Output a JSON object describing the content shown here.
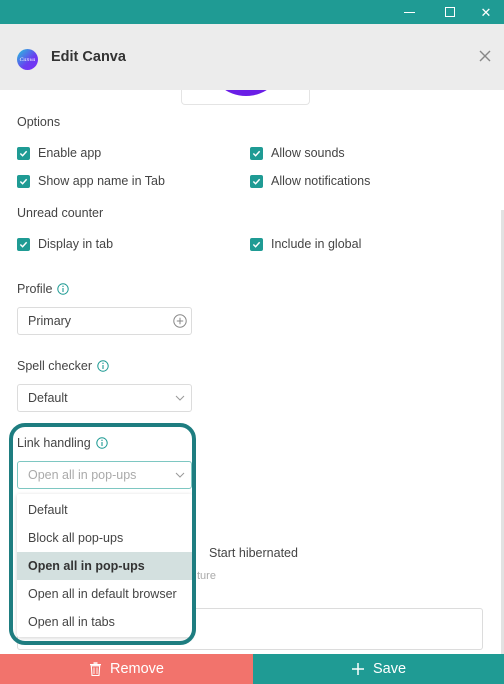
{
  "window": {
    "minimize_glyph": "",
    "maximize_glyph": "",
    "close_glyph": "✕"
  },
  "header": {
    "logo_text": "Canva",
    "title": "Edit Canva",
    "close_icon": "close-icon"
  },
  "options": {
    "label": "Options",
    "enable_app": "Enable app",
    "allow_sounds": "Allow sounds",
    "show_app_name": "Show app name in Tab",
    "allow_notifications": "Allow notifications"
  },
  "unread": {
    "label": "Unread counter",
    "display_in_tab": "Display in tab",
    "include_in_global": "Include in global"
  },
  "profile": {
    "label": "Profile",
    "value": "Primary"
  },
  "spell": {
    "label": "Spell checker",
    "value": "Default"
  },
  "link_handling": {
    "label": "Link handling",
    "value": "Open all in pop-ups",
    "options": [
      "Default",
      "Block all pop-ups",
      "Open all in pop-ups",
      "Open all in default browser",
      "Open all in tabs"
    ],
    "selected_index": 2
  },
  "hibernation": {
    "label": "Start hibernated",
    "sub": "ture"
  },
  "footer": {
    "remove": "Remove",
    "save": "Save"
  },
  "colors": {
    "accent": "#1f9b94",
    "remove": "#f2736c",
    "highlight": "#1e7d80"
  }
}
